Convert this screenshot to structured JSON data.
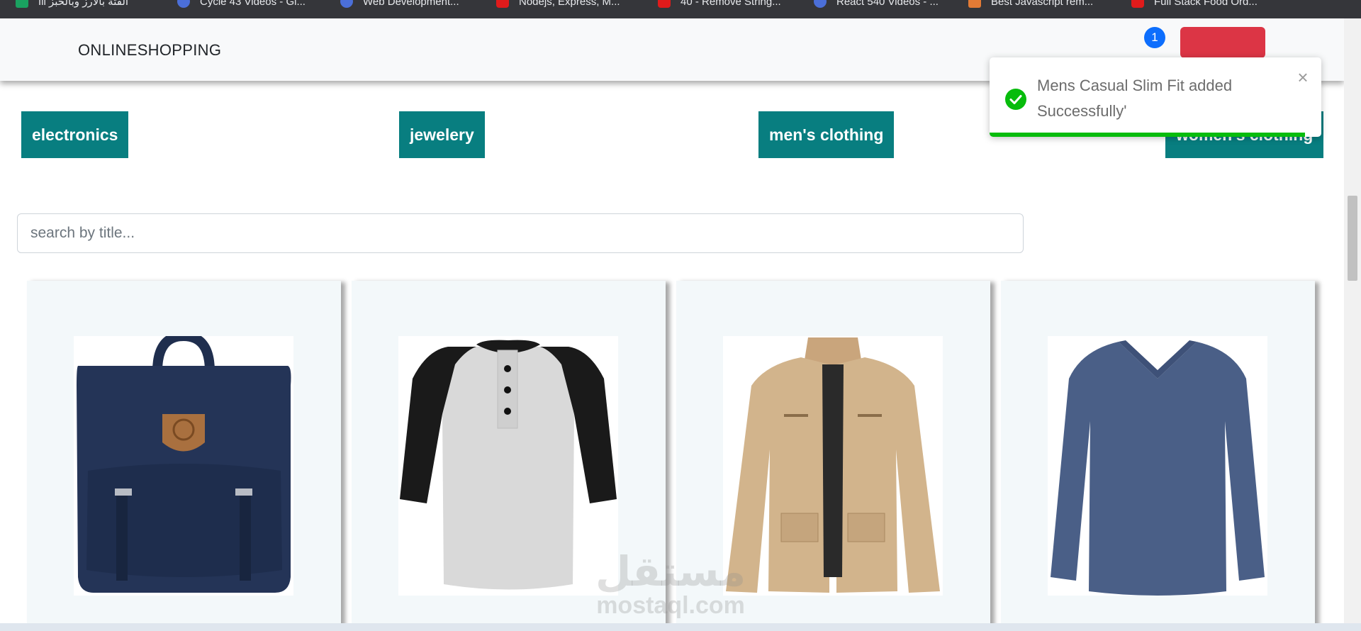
{
  "bookmarks": [
    {
      "label": "Ill الفتة بالأرز وبالخبز",
      "color": "green"
    },
    {
      "label": "Cycle 43 Videos - Gi...",
      "color": "blue"
    },
    {
      "label": "Web Development...",
      "color": "blue"
    },
    {
      "label": "Nodejs, Express, M...",
      "color": "red"
    },
    {
      "label": "40 - Remove String...",
      "color": "red"
    },
    {
      "label": "React 540 Videos - ...",
      "color": "blue"
    },
    {
      "label": "Best Javascript rem...",
      "color": "orange"
    },
    {
      "label": "Full Stack Food Ord...",
      "color": "red"
    }
  ],
  "navbar": {
    "brand": "ONLINESHOPPING",
    "cart_count": "1"
  },
  "categories": [
    {
      "label": "electronics"
    },
    {
      "label": "jewelery"
    },
    {
      "label": "men's clothing"
    },
    {
      "label": "women's clothing"
    }
  ],
  "search": {
    "placeholder": "search by title...",
    "value": ""
  },
  "products": [
    {
      "image": "backpack-image"
    },
    {
      "image": "henley-shirt-image"
    },
    {
      "image": "cotton-jacket-image"
    },
    {
      "image": "slim-fit-shirt-image"
    }
  ],
  "toast": {
    "message": "Mens Casual Slim Fit added Successfully'",
    "close_symbol": "×",
    "icon": "check-circle-icon",
    "progress": 0.95,
    "color": "#07bc0c"
  },
  "watermark": {
    "arabic": "مستقل",
    "latin": "mostaql.com"
  },
  "colors": {
    "category_bg": "#087e80",
    "navbar_bg": "#f8f9fa",
    "card_bg": "#f3f8fa",
    "badge": "#0d6efd",
    "nav_button": "#dc3545"
  }
}
